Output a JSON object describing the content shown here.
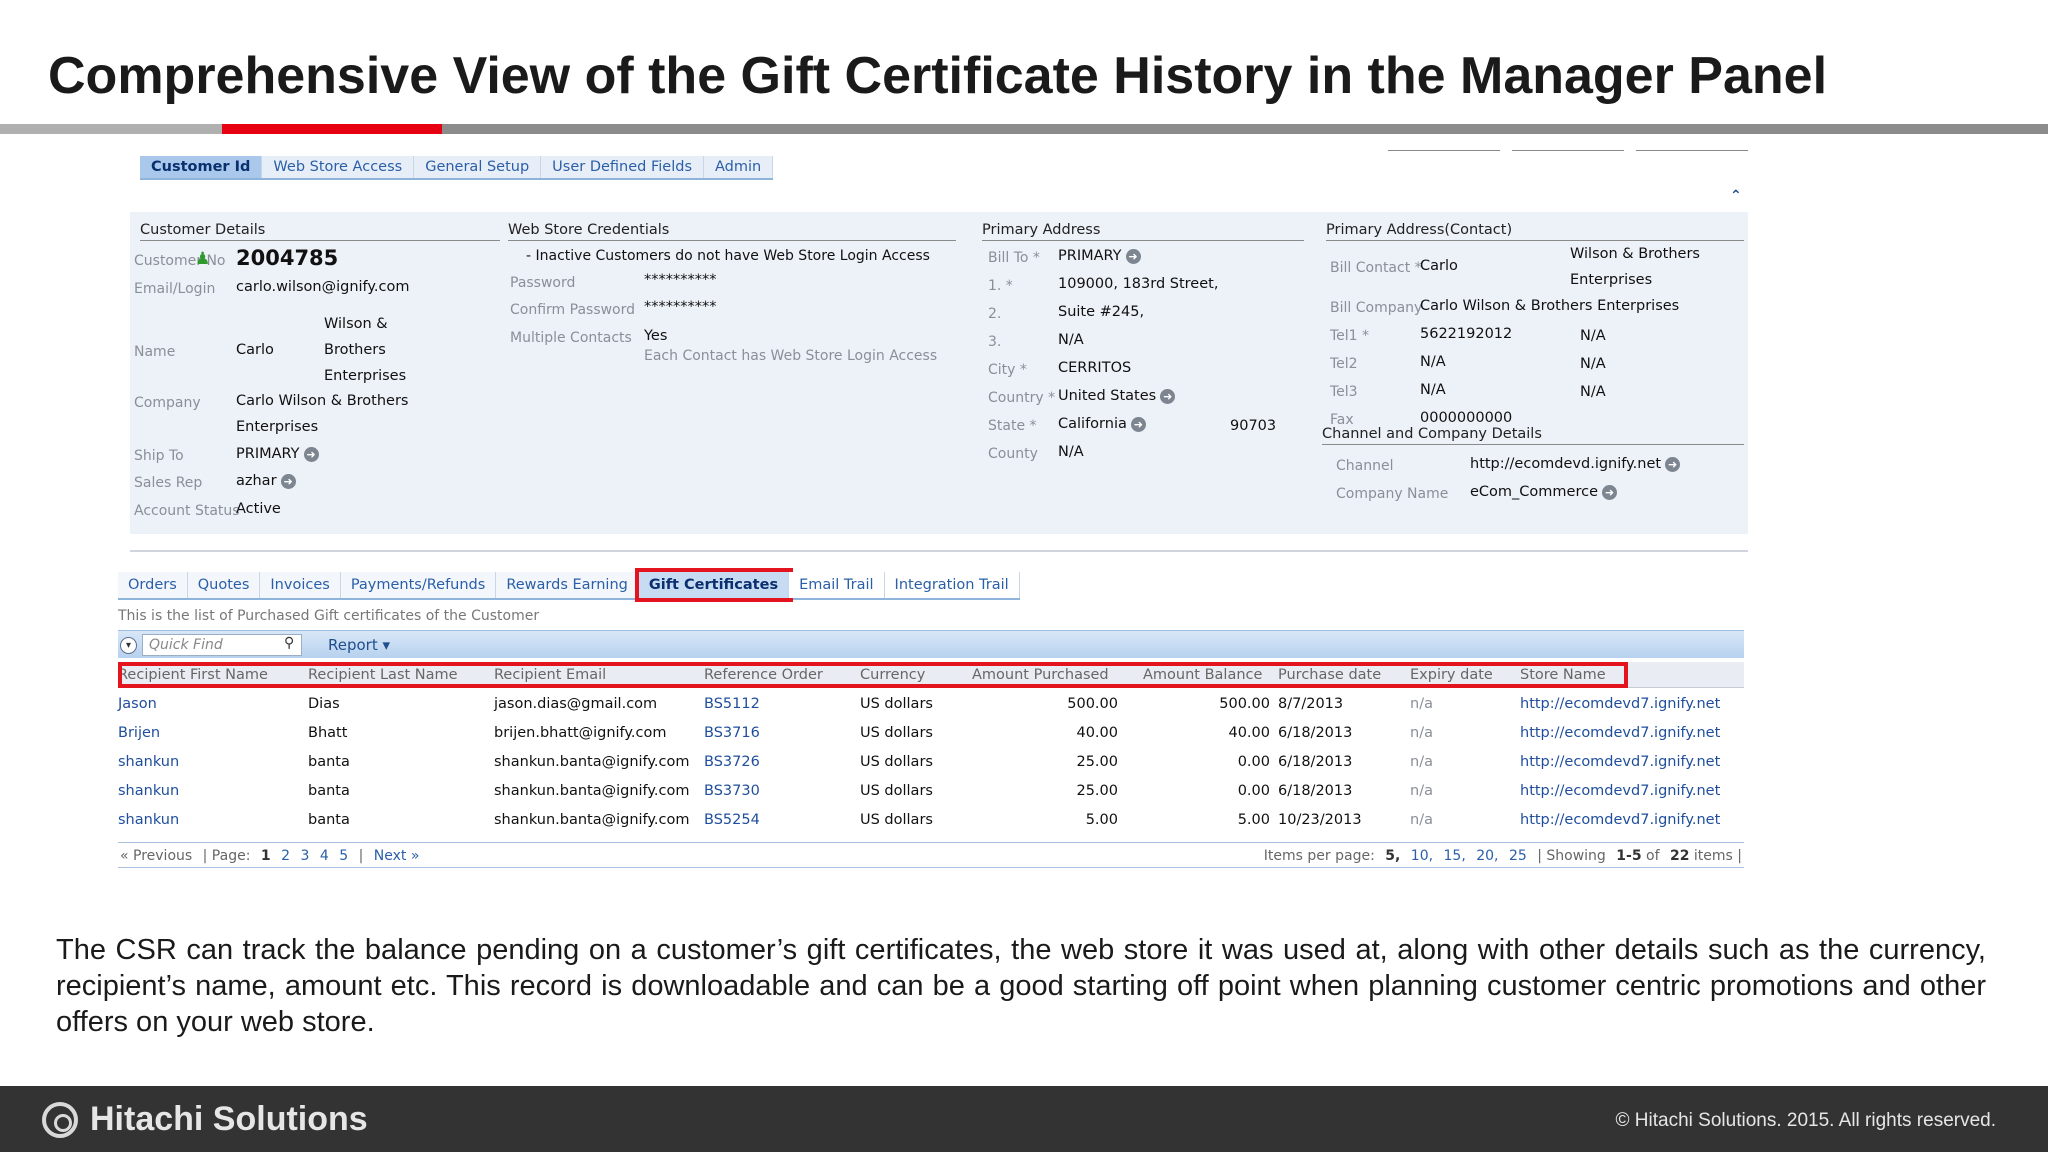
{
  "slide": {
    "title": "Comprehensive View of the Gift Certificate History in the Manager Panel",
    "description": "The CSR can track the balance pending on a customer’s gift certificates, the web store it was used at, along with other details such as the currency, recipient’s name, amount etc. This record is downloadable and can be a good starting off point when planning customer centric promotions and other offers on your web store.",
    "footer_logo": "Hitachi Solutions",
    "copyright": "©  Hitachi Solutions. 2015. All rights reserved.",
    "accent_color": "#e60012"
  },
  "top_tabs": [
    "Customer Id",
    "Web Store Access",
    "General Setup",
    "User Defined Fields",
    "Admin"
  ],
  "customer_details": {
    "heading": "Customer Details",
    "customer_no_label": "Customer No",
    "customer_no": "2004785",
    "email_label": "Email/Login",
    "email": "carlo.wilson@ignify.com",
    "name_label": "Name",
    "first_name": "Carlo",
    "last_name_lines": [
      "Wilson &",
      "Brothers",
      "Enterprises"
    ],
    "company_label": "Company",
    "company_lines": [
      "Carlo Wilson & Brothers",
      "Enterprises"
    ],
    "ship_to_label": "Ship To",
    "ship_to": "PRIMARY",
    "sales_rep_label": "Sales Rep",
    "sales_rep": "azhar",
    "status_label": "Account Status",
    "status": "Active"
  },
  "web_store_credentials": {
    "heading": "Web Store Credentials",
    "notice": "- Inactive Customers do not have Web Store Login Access",
    "password_label": "Password",
    "password": "**********",
    "confirm_label": "Confirm Password",
    "confirm": "**********",
    "multiple_label": "Multiple Contacts",
    "multiple": "Yes",
    "multiple_note": "Each Contact has Web Store Login Access"
  },
  "primary_address": {
    "heading": "Primary Address",
    "bill_to_label": "Bill To *",
    "bill_to": "PRIMARY",
    "line1_label": "1. *",
    "line1": "109000, 183rd Street,",
    "line2_label": "2.",
    "line2": "Suite #245,",
    "line3_label": "3.",
    "line3": "N/A",
    "city_label": "City *",
    "city": "CERRITOS",
    "country_label": "Country *",
    "country": "United States",
    "state_label": "State *",
    "state": "California",
    "zip": "90703",
    "county_label": "County",
    "county": "N/A"
  },
  "primary_contact": {
    "heading": "Primary Address(Contact)",
    "bill_contact_label": "Bill Contact *",
    "bill_contact": "Carlo",
    "bill_contact_last_lines": [
      "Wilson & Brothers",
      "Enterprises"
    ],
    "bill_company_label": "Bill Company",
    "bill_company": "Carlo Wilson & Brothers Enterprises",
    "tel1_label": "Tel1 *",
    "tel1": "5622192012",
    "tel1_ext": "N/A",
    "tel2_label": "Tel2",
    "tel2": "N/A",
    "tel2_ext": "N/A",
    "tel3_label": "Tel3",
    "tel3": "N/A",
    "tel3_ext": "N/A",
    "fax_label": "Fax",
    "fax": "0000000000",
    "channel_heading": "Channel and Company Details",
    "channel_label": "Channel",
    "channel": "http://ecomdevd.ignify.net",
    "company_name_label": "Company Name",
    "company_name": "eCom_Commerce"
  },
  "sub_tabs": [
    "Orders",
    "Quotes",
    "Invoices",
    "Payments/Refunds",
    "Rewards Earning",
    "Gift Certificates",
    "Email Trail",
    "Integration Trail"
  ],
  "list_caption": "This is the list of Purchased Gift certificates of the Customer",
  "toolbar": {
    "quick_find_placeholder": "Quick Find",
    "report_label": "Report ▾"
  },
  "grid": {
    "columns": [
      "Recipient First Name",
      "Recipient Last Name",
      "Recipient Email",
      "Reference Order",
      "Currency",
      "Amount Purchased",
      "Amount Balance",
      "Purchase date",
      "Expiry date",
      "Store Name"
    ],
    "rows": [
      [
        "Jason",
        "Dias",
        "jason.dias@gmail.com",
        "BS5112",
        "US dollars",
        "500.00",
        "500.00",
        "8/7/2013",
        "n/a",
        "http://ecomdevd7.ignify.net"
      ],
      [
        "Brijen",
        "Bhatt",
        "brijen.bhatt@ignify.com",
        "BS3716",
        "US dollars",
        "40.00",
        "40.00",
        "6/18/2013",
        "n/a",
        "http://ecomdevd7.ignify.net"
      ],
      [
        "shankun",
        "banta",
        "shankun.banta@ignify.com",
        "BS3726",
        "US dollars",
        "25.00",
        "0.00",
        "6/18/2013",
        "n/a",
        "http://ecomdevd7.ignify.net"
      ],
      [
        "shankun",
        "banta",
        "shankun.banta@ignify.com",
        "BS3730",
        "US dollars",
        "25.00",
        "0.00",
        "6/18/2013",
        "n/a",
        "http://ecomdevd7.ignify.net"
      ],
      [
        "shankun",
        "banta",
        "shankun.banta@ignify.com",
        "BS5254",
        "US dollars",
        "5.00",
        "5.00",
        "10/23/2013",
        "n/a",
        "http://ecomdevd7.ignify.net"
      ]
    ]
  },
  "pager": {
    "previous": "« Previous",
    "page_label": "| Page:",
    "pages": [
      "1",
      "2",
      "3",
      "4",
      "5"
    ],
    "separator": "|",
    "next": "Next »",
    "items_label": "Items per page:",
    "sizes": [
      "5,",
      "10,",
      "15,",
      "20,",
      "25"
    ],
    "showing": "| Showing",
    "range": "1-5",
    "of": "of",
    "total": "22",
    "items": "items |"
  }
}
